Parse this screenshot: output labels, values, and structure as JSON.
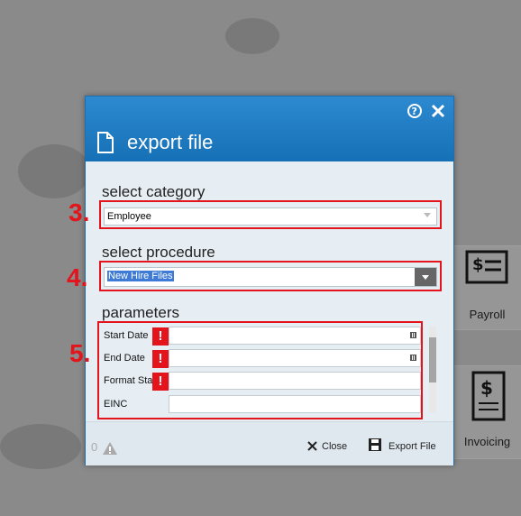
{
  "dialog": {
    "title": "export file",
    "select_category_label": "select category",
    "category_value": "Employee",
    "select_procedure_label": "select procedure",
    "procedure_value": "New Hire Files",
    "parameters_label": "parameters",
    "params": [
      {
        "label": "Start Date",
        "error": "!"
      },
      {
        "label": "End Date",
        "error": "!"
      },
      {
        "label": "Format Status",
        "error": "!"
      },
      {
        "label": "EINC"
      }
    ],
    "footer": {
      "error_count": "0",
      "close_label": "Close",
      "export_label": "Export File"
    }
  },
  "annotations": {
    "step3": "3.",
    "step4": "4.",
    "step5": "5."
  },
  "tiles": {
    "payroll": "Payroll",
    "invoicing": "Invoicing"
  },
  "colors": {
    "header_blue": "#1670b6",
    "annotation_red": "#e3141b"
  }
}
